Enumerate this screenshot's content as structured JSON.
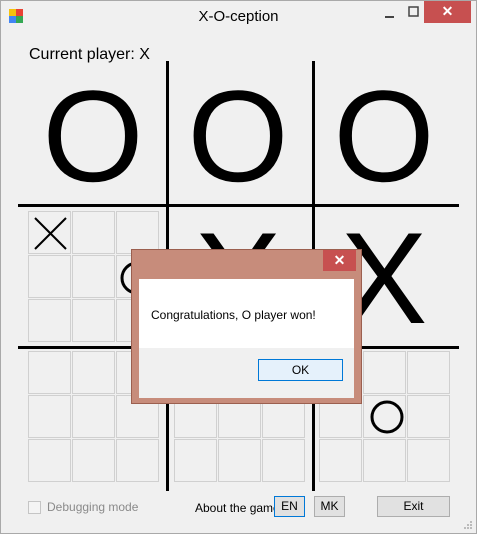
{
  "window": {
    "title": "X-O-ception",
    "close_glyph": "✕"
  },
  "status": {
    "current_player": "Current player: X"
  },
  "board": {
    "big_marks": [
      "O",
      "O",
      "O",
      "X",
      "X"
    ],
    "sub_marks": [
      "X",
      "O",
      "O"
    ]
  },
  "footer": {
    "debug_label": "Debugging mode",
    "about_label": "About the game",
    "en_label": "EN",
    "mk_label": "MK",
    "exit_label": "Exit"
  },
  "dialog": {
    "close_glyph": "✕",
    "message": "Congratulations, O player won!",
    "ok_label": "OK"
  },
  "colors": {
    "close_red": "#c75050",
    "dialog_frame": "#c78c7b",
    "focus_blue": "#0078d7"
  },
  "icons": [
    "app-icon",
    "minimize-icon",
    "maximize-icon",
    "close-icon",
    "checkbox-icon",
    "resize-grip-icon"
  ]
}
